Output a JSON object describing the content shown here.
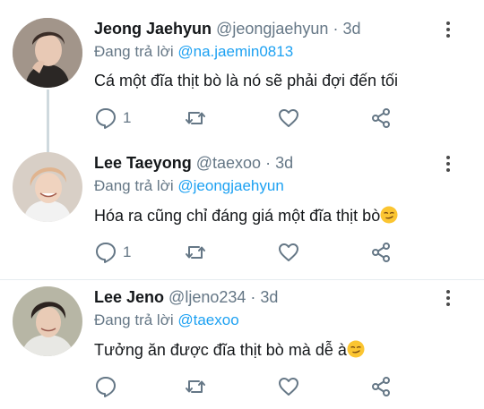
{
  "tweets": [
    {
      "name": "Jeong Jaehyun",
      "handle": "@jeongjaehyun",
      "dot": "·",
      "time": "3d",
      "reply_prefix": "Đang trả lời",
      "reply_to": "@na.jaemin0813",
      "text": "Cá một đĩa thịt bò là nó sẽ phải đợi đến tối",
      "reply_count": "1",
      "has_emoji": false
    },
    {
      "name": "Lee Taeyong",
      "handle": "@taexoo",
      "dot": "·",
      "time": "3d",
      "reply_prefix": "Đang trả lời",
      "reply_to": "@jeongjaehyun",
      "text": "Hóa ra cũng chỉ đáng giá một đĩa thịt bò",
      "reply_count": "1",
      "has_emoji": true
    },
    {
      "name": "Lee Jeno",
      "handle": "@ljeno234",
      "dot": "·",
      "time": "3d",
      "reply_prefix": "Đang trả lời",
      "reply_to": "@taexoo",
      "text": "Tưởng ăn được đĩa thịt bò mà dễ à",
      "reply_count": "",
      "has_emoji": true
    }
  ],
  "icons": {
    "reply": "comment-icon",
    "retweet": "retweet-icon",
    "like": "heart-icon",
    "share": "share-icon",
    "more": "more-vertical-icon",
    "emoji": "smirk-emoji-icon"
  },
  "colors": {
    "name": "#14171a",
    "secondary": "#657786",
    "mention": "#1da1f2",
    "icon": "#657786",
    "divider": "#e6ecf0",
    "thread_line": "#cfd9de"
  }
}
